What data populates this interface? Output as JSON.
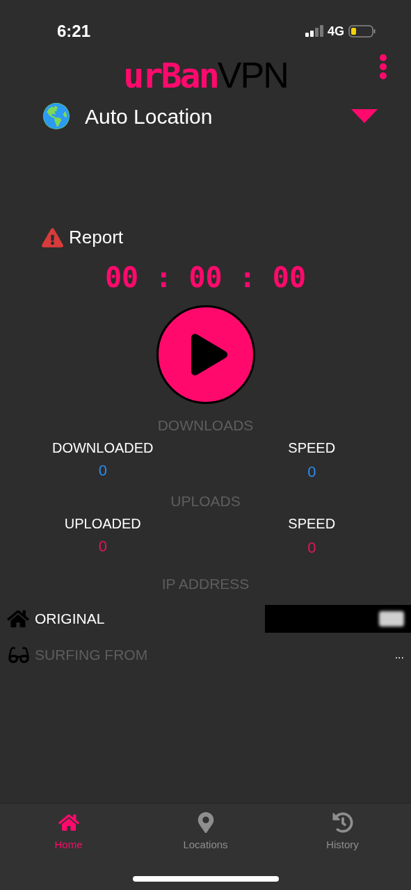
{
  "status_bar": {
    "time": "6:21",
    "network": "4G"
  },
  "header": {
    "logo_brand": "urBan",
    "logo_suffix": "VPN"
  },
  "location": {
    "label": "Auto Location"
  },
  "report": {
    "label": "Report"
  },
  "timer": "00 : 00 : 00",
  "connect": {
    "connected": false
  },
  "downloads": {
    "title": "DOWNLOADS",
    "left_label": "DOWNLOADED",
    "left_value": "0",
    "right_label": "SPEED",
    "right_value": "0"
  },
  "uploads": {
    "title": "UPLOADS",
    "left_label": "UPLOADED",
    "left_value": "0",
    "right_label": "SPEED",
    "right_value": "0"
  },
  "ip": {
    "title": "IP ADDRESS",
    "original_label": "ORIGINAL",
    "surfing_label": "SURFING FROM",
    "surfing_value": "..."
  },
  "tabs": [
    {
      "label": "Home",
      "kind": "home",
      "selected": true
    },
    {
      "label": "Locations",
      "kind": "pin",
      "selected": false
    },
    {
      "label": "History",
      "kind": "history",
      "selected": false
    }
  ]
}
